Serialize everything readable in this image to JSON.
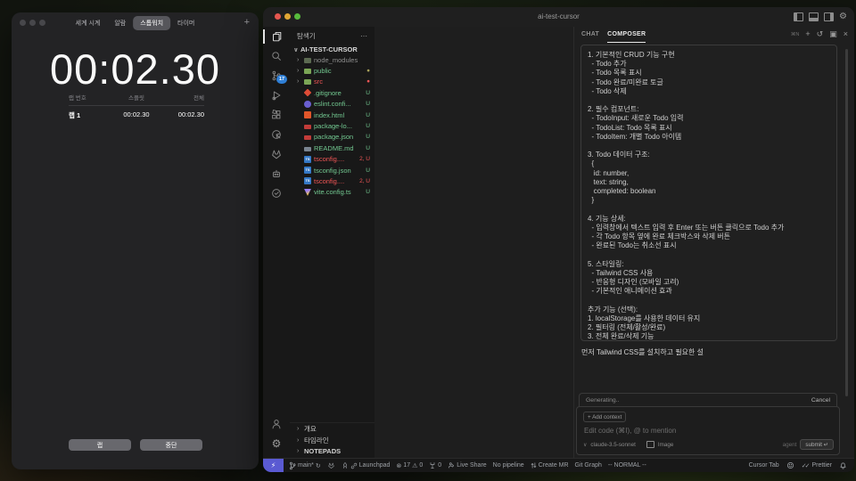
{
  "stopwatch": {
    "tabs": [
      {
        "label": "세계 시계",
        "cls": ""
      },
      {
        "label": "알람",
        "cls": ""
      },
      {
        "label": "스톱워치",
        "cls": "active"
      },
      {
        "label": "타이머",
        "cls": ""
      }
    ],
    "add_label": "+",
    "time": "00:02.30",
    "table": {
      "col_lap": "랩 번호",
      "col_split": "스플릿",
      "col_total": "전체",
      "rows": [
        {
          "lap": "랩 1",
          "split": "00:02.30",
          "total": "00:02.30"
        }
      ]
    },
    "lap_button": "랩",
    "stop_button": "중단"
  },
  "vscode": {
    "title": "ai-test-cursor",
    "activity": {
      "scm_badge": "17"
    },
    "explorer": {
      "header": "탐색기",
      "more": "⋯",
      "root_chevron": "∨",
      "root": "AI-TEST-CURSOR",
      "files": [
        {
          "chev": "›",
          "icon": "i-folder f-dim",
          "name": "node_modules",
          "cls": "dim",
          "status": "",
          "scls": ""
        },
        {
          "chev": "›",
          "icon": "i-folder f-green",
          "name": "public",
          "cls": "green",
          "status": "●",
          "scls": "olive"
        },
        {
          "chev": "›",
          "icon": "i-folder f-green",
          "name": "src",
          "cls": "red",
          "status": "●",
          "scls": "red"
        },
        {
          "chev": "",
          "icon": "i-git",
          "name": ".gitignore",
          "cls": "green",
          "status": "U",
          "scls": "green"
        },
        {
          "chev": "",
          "icon": "i-eslint",
          "name": "eslint.confi...",
          "cls": "green",
          "status": "U",
          "scls": "green"
        },
        {
          "chev": "",
          "icon": "i-html",
          "name": "index.html",
          "cls": "green",
          "status": "U",
          "scls": "green"
        },
        {
          "chev": "",
          "icon": "i-npm",
          "name": "package-lo...",
          "cls": "green",
          "status": "U",
          "scls": "green"
        },
        {
          "chev": "",
          "icon": "i-npm",
          "name": "package.json",
          "cls": "green",
          "status": "U",
          "scls": "green"
        },
        {
          "chev": "",
          "icon": "i-md",
          "name": "README.md",
          "cls": "green",
          "status": "U",
          "scls": "green"
        },
        {
          "chev": "",
          "icon": "i-ts",
          "name": "tsconfig....",
          "cls": "red",
          "status": "2, U",
          "scls": "red"
        },
        {
          "chev": "",
          "icon": "i-ts",
          "name": "tsconfig.json",
          "cls": "green",
          "status": "U",
          "scls": "green"
        },
        {
          "chev": "",
          "icon": "i-ts",
          "name": "tsconfig....",
          "cls": "red",
          "status": "2, U",
          "scls": "red"
        },
        {
          "chev": "",
          "icon": "i-vite",
          "name": "vite.config.ts",
          "cls": "green",
          "status": "U",
          "scls": "green"
        }
      ],
      "sections": [
        {
          "chev": "›",
          "label": "개요",
          "cls": ""
        },
        {
          "chev": "›",
          "label": "타임라인",
          "cls": ""
        },
        {
          "chev": "›",
          "label": "NOTEPADS",
          "cls": "bold"
        }
      ]
    },
    "chat": {
      "tabs": [
        {
          "label": "CHAT",
          "cls": ""
        },
        {
          "label": "COMPOSER",
          "cls": "active"
        }
      ],
      "shortcut": "⌘N",
      "new_label": "+",
      "history_icon": "↺",
      "expand_icon": "▣",
      "close_icon": "×",
      "message_lines": [
        "1. 기본적인 CRUD 기능 구현",
        "  - Todo 추가",
        "  - Todo 목록 표시",
        "  - Todo 완료/미완료 토글",
        "  - Todo 삭제",
        "",
        "2. 필수 컴포넌트:",
        "  - TodoInput: 새로운 Todo 입력",
        "  - TodoList: Todo 목록 표시",
        "  - TodoItem: 개별 Todo 아이템",
        "",
        "3. Todo 데이터 구조:",
        "  {",
        "   id: number,",
        "   text: string,",
        "   completed: boolean",
        "  }",
        "",
        "4. 기능 상세:",
        "  - 입력창에서 텍스트 입력 후 Enter 또는 버튼 클릭으로 Todo 추가",
        "  - 각 Todo 항목 옆에 완료 체크박스와 삭제 버튼",
        "  - 완료된 Todo는 취소선 표시",
        "",
        "5. 스타일링:",
        "  - Tailwind CSS 사용",
        "  - 반응형 디자인 (모바일 고려)",
        "  - 기본적인 애니메이션 효과",
        "",
        "추가 기능 (선택):",
        "1. localStorage를 사용한 데이터 유지",
        "2. 필터링 (전체/활성/완료)",
        "3. 전체 완료/삭제 기능"
      ],
      "response": "먼저 Tailwind CSS를 설치하고 필요한 설",
      "generating": "Generating..",
      "cancel": "Cancel",
      "add_context": "+ Add context",
      "placeholder": "Edit code (⌘I), @ to mention",
      "model_chevron": "∨",
      "model": "claude-3.5-sonnet",
      "image_label": "Image",
      "agent_label": "agent",
      "submit_label": "submit ↵"
    },
    "status": {
      "remote_icon": "⚡",
      "branch": "main*",
      "sync_icon": "↻",
      "launchpad": "Launchpad",
      "error_icon": "⊗",
      "errors": "17",
      "warning_icon": "⚠",
      "warnings": "0",
      "ports": "0",
      "live_share": "Live Share",
      "pipeline": "No pipeline",
      "create_mr": "Create MR",
      "git_graph": "Git Graph",
      "mode": "-- NORMAL --",
      "cursor_tab": "Cursor Tab",
      "prettier_check": "✓✓",
      "prettier": "Prettier"
    }
  }
}
